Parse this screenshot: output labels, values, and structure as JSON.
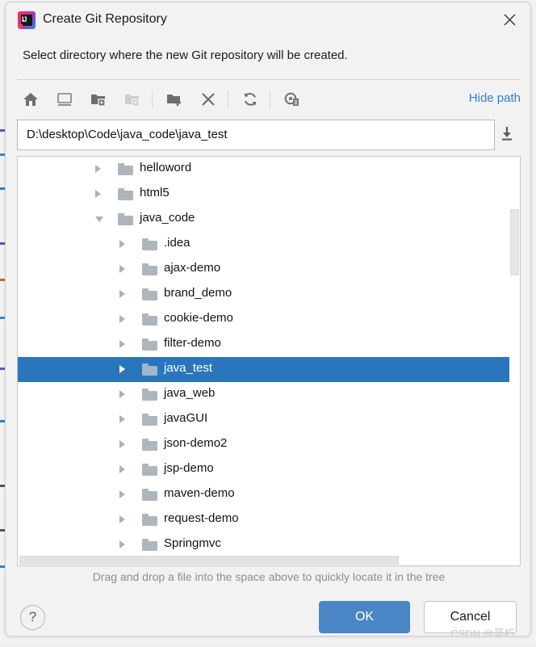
{
  "window": {
    "title": "Create Git Repository",
    "app_icon": "intellij-idea-icon",
    "close_icon": "close-icon",
    "prompt": "Select directory where the new Git repository will be created."
  },
  "toolbar": {
    "items": [
      {
        "name": "home-icon",
        "tooltip": "Home"
      },
      {
        "name": "desktop-icon",
        "tooltip": "Desktop"
      },
      {
        "name": "project-folder-icon",
        "tooltip": "Project Directory"
      },
      {
        "name": "module-folder-icon",
        "tooltip": "Module Directory",
        "disabled": true
      },
      {
        "name": "new-folder-icon",
        "tooltip": "New Folder"
      },
      {
        "name": "delete-icon",
        "tooltip": "Delete"
      },
      {
        "name": "refresh-icon",
        "tooltip": "Refresh"
      },
      {
        "name": "show-hidden-icon",
        "tooltip": "Show Hidden Files and Directories"
      }
    ],
    "hide_path_label": "Hide path"
  },
  "path": {
    "value": "D:\\desktop\\Code\\java_code\\java_test",
    "placeholder": "",
    "expand_icon": "download-arrow-icon"
  },
  "tree": {
    "rows": [
      {
        "label": "helloword",
        "depth": 1,
        "expanded": false,
        "selected": false
      },
      {
        "label": "html5",
        "depth": 1,
        "expanded": false,
        "selected": false
      },
      {
        "label": "java_code",
        "depth": 1,
        "expanded": true,
        "selected": false
      },
      {
        "label": ".idea",
        "depth": 2,
        "expanded": false,
        "selected": false
      },
      {
        "label": "ajax-demo",
        "depth": 2,
        "expanded": false,
        "selected": false
      },
      {
        "label": "brand_demo",
        "depth": 2,
        "expanded": false,
        "selected": false
      },
      {
        "label": "cookie-demo",
        "depth": 2,
        "expanded": false,
        "selected": false
      },
      {
        "label": "filter-demo",
        "depth": 2,
        "expanded": false,
        "selected": false
      },
      {
        "label": "java_test",
        "depth": 2,
        "expanded": false,
        "selected": true
      },
      {
        "label": "java_web",
        "depth": 2,
        "expanded": false,
        "selected": false
      },
      {
        "label": "javaGUI",
        "depth": 2,
        "expanded": false,
        "selected": false
      },
      {
        "label": "json-demo2",
        "depth": 2,
        "expanded": false,
        "selected": false
      },
      {
        "label": "jsp-demo",
        "depth": 2,
        "expanded": false,
        "selected": false
      },
      {
        "label": "maven-demo",
        "depth": 2,
        "expanded": false,
        "selected": false
      },
      {
        "label": "request-demo",
        "depth": 2,
        "expanded": false,
        "selected": false
      },
      {
        "label": "Springmvc",
        "depth": 2,
        "expanded": false,
        "selected": false
      }
    ]
  },
  "hint": "Drag and drop a file into the space above to quickly locate it in the tree",
  "footer": {
    "help_label": "?",
    "ok_label": "OK",
    "cancel_label": "Cancel"
  },
  "watermark": "CSDN @蓝朽",
  "colors": {
    "accent": "#2a76bd",
    "ok_button": "#4a86c5",
    "link": "#2f7fd0",
    "folder": "#aeb6bd",
    "dialog_bg": "#f2f2f2"
  }
}
